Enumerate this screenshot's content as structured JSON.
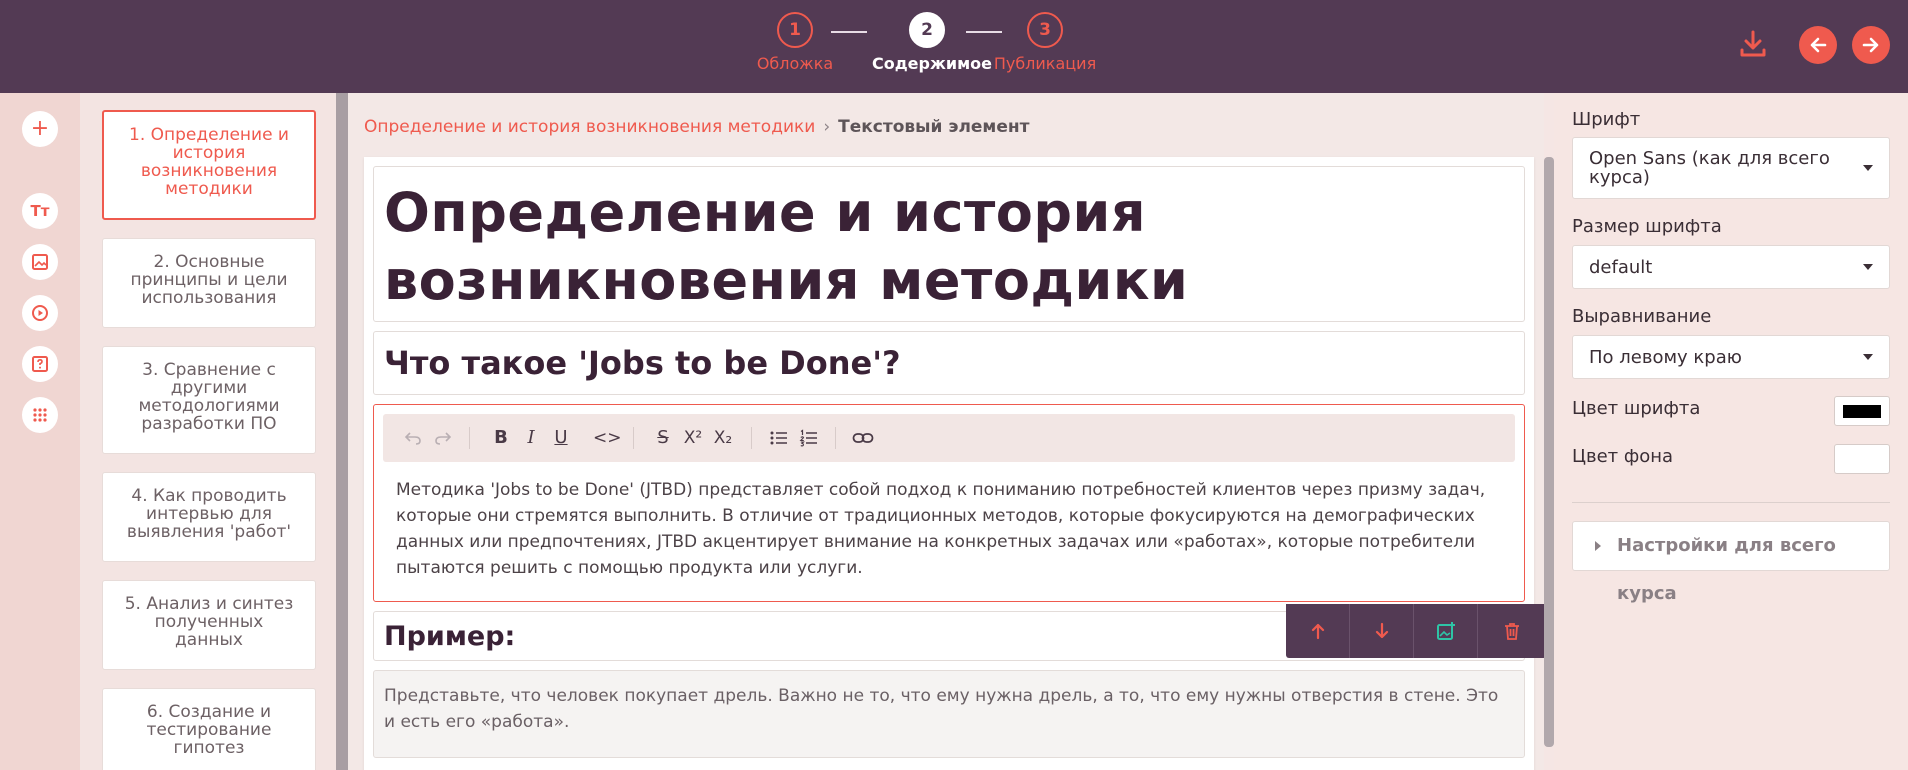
{
  "header": {
    "steps": [
      {
        "number": "1",
        "label": "Обложка"
      },
      {
        "number": "2",
        "label": "Содержимое"
      },
      {
        "number": "3",
        "label": "Публикация"
      }
    ],
    "active_step": 2
  },
  "rail": {
    "add_glyph": "+",
    "text_glyph": "Тт",
    "icons": [
      "plus-icon",
      "text-icon",
      "image-icon",
      "video-icon",
      "quiz-icon",
      "grid-icon"
    ]
  },
  "chapters": [
    {
      "label": "1. Определение и история возникновения методики"
    },
    {
      "label": "2. Основные принципы и цели использования"
    },
    {
      "label": "3. Сравнение с другими методологиями разработки ПО"
    },
    {
      "label": "4. Как проводить интервью для выявления 'работ'"
    },
    {
      "label": "5. Анализ и синтез полученных данных"
    },
    {
      "label": "6. Создание и тестирование гипотез"
    }
  ],
  "breadcrumb": {
    "link": "Определение и история возникновения методики",
    "separator": "›",
    "current": "Текстовый элемент"
  },
  "content": {
    "title": "Определение и история возникновения методики",
    "subtitle": "Что такое 'Jobs to be Done'?",
    "editor_text": "Методика 'Jobs to be Done' (JTBD) представляет собой подход к пониманию потребностей клиентов через призму задач, которые они стремятся выполнить. В отличие от традиционных методов, которые фокусируются на демографических данных или предпочтениях, JTBD акцентирует внимание на конкретных задачах или «работах», которые потребители пытаются решить с помощью продукта или услуги.",
    "example_heading": "Пример:",
    "example_text": "Представьте, что человек покупает дрель. Важно не то, что ему нужна дрель, а то, что ему нужны отверстия в стене. Это и есть его «работа»."
  },
  "toolbar": {
    "bold": "B",
    "italic": "I",
    "underline": "U",
    "code": "<>",
    "strike": "S",
    "superscript": "X²",
    "subscript": "X₂"
  },
  "panel": {
    "font_label": "Шрифт",
    "font_value": "Open Sans (как для всего курса)",
    "size_label": "Размер шрифта",
    "size_value": "default",
    "align_label": "Выравнивание",
    "align_value": "По левому краю",
    "font_color_label": "Цвет шрифта",
    "font_color": "#000000",
    "bg_color_label": "Цвет фона",
    "bg_color": "#ffffff",
    "course_settings": "Настройки для всего курса"
  },
  "colors": {
    "accent": "#ef5a4e",
    "header_bg": "#533a54",
    "heading_text": "#3a2236",
    "teal_icon": "#2ec4a6"
  }
}
